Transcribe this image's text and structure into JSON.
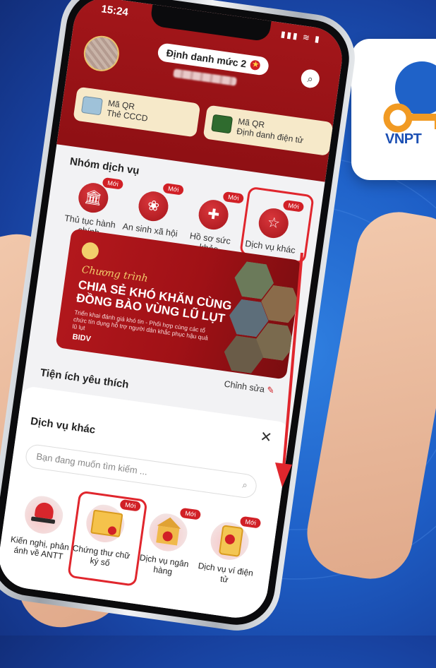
{
  "status": {
    "time": "15:24",
    "icons": "▮▮▮ ≋ ▮"
  },
  "header": {
    "level_label": "Định danh mức 2",
    "search_icon": "search-icon"
  },
  "qr_cards": [
    {
      "line1": "Mã QR",
      "line2": "Thẻ CCCD"
    },
    {
      "line1": "Mã QR",
      "line2": "Định danh điện tử"
    }
  ],
  "services_group": {
    "title": "Nhóm dịch vụ",
    "new_badge": "Mới",
    "items": [
      {
        "label": "Thủ tục hành chính",
        "icon": "building-icon"
      },
      {
        "label": "An sinh xã hội",
        "icon": "heart-hands-icon"
      },
      {
        "label": "Hồ sơ sức khỏe",
        "icon": "health-icon"
      },
      {
        "label": "Dịch vụ khác",
        "icon": "star-box-icon"
      }
    ]
  },
  "banner": {
    "script": "Chương trình",
    "headline": "CHIA SẺ KHÓ KHĂN CÙNG ĐỒNG BÀO VÙNG LŨ LỤT",
    "sub": "Triển khai đánh giá khó tin - Phối hợp cùng các tổ chức tín dụng hỗ trợ người dân khắc phục hậu quả lũ lụt",
    "brand": "BIDV"
  },
  "favorites": {
    "title": "Tiện ích yêu thích",
    "edit_label": "Chỉnh sửa"
  },
  "sheet": {
    "title": "Dịch vụ khác",
    "search_placeholder": "Bạn đang muốn tìm kiếm ...",
    "new_badge": "Mới",
    "items": [
      {
        "label": "Kiến nghị, phản ánh về ANTT",
        "icon": "siren-icon"
      },
      {
        "label": "Chứng thư chữ ký số",
        "icon": "certificate-icon"
      },
      {
        "label": "Dịch vụ ngân hàng",
        "icon": "bank-icon"
      },
      {
        "label": "Dịch vụ ví điện tử",
        "icon": "e-wallet-icon"
      }
    ]
  },
  "vnpt": {
    "text": "VNPT"
  },
  "colors": {
    "primary_red": "#a3161a",
    "highlight": "#e0262d",
    "background_blue": "#1e5fc7"
  }
}
